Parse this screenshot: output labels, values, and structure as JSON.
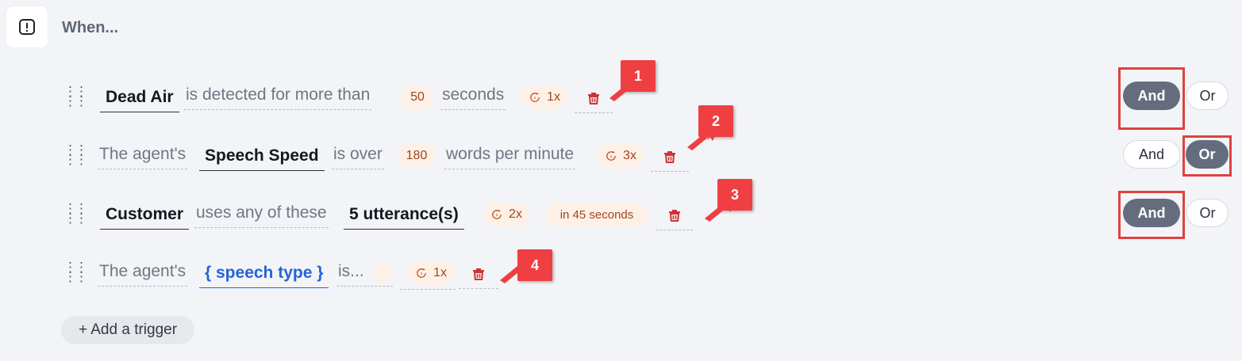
{
  "header": {
    "title": "When...",
    "icon": "alert-square-icon"
  },
  "rows": [
    {
      "subject": "Dead Air",
      "text1": "is detected for more than",
      "value": "50",
      "unit": "seconds",
      "repeat": "1x",
      "logic": {
        "and": "And",
        "or": "Or",
        "selected": "And"
      }
    },
    {
      "prefix": "The agent's",
      "subject": "Speech Speed",
      "text1": "is over",
      "value": "180",
      "unit": "words per minute",
      "repeat": "3x",
      "logic": {
        "and": "And",
        "or": "Or",
        "selected": "Or"
      }
    },
    {
      "subject": "Customer",
      "text1": "uses any of these",
      "value": "5 utterance(s)",
      "repeat": "2x",
      "window": "in 45 seconds",
      "logic": {
        "and": "And",
        "or": "Or",
        "selected": "And"
      }
    },
    {
      "prefix": "The agent's",
      "subject": "{ speech type }",
      "text1": "is...",
      "repeat": "1x"
    }
  ],
  "callouts": [
    "1",
    "2",
    "3",
    "4"
  ],
  "add_trigger": "+ Add a trigger",
  "colors": {
    "callout": "#ef3f43",
    "toggle_active": "#646c7e",
    "chip_bg": "#fdf1e7",
    "chip_text": "#a2441d",
    "trash": "#d03234",
    "link_blue": "#2364d6"
  }
}
